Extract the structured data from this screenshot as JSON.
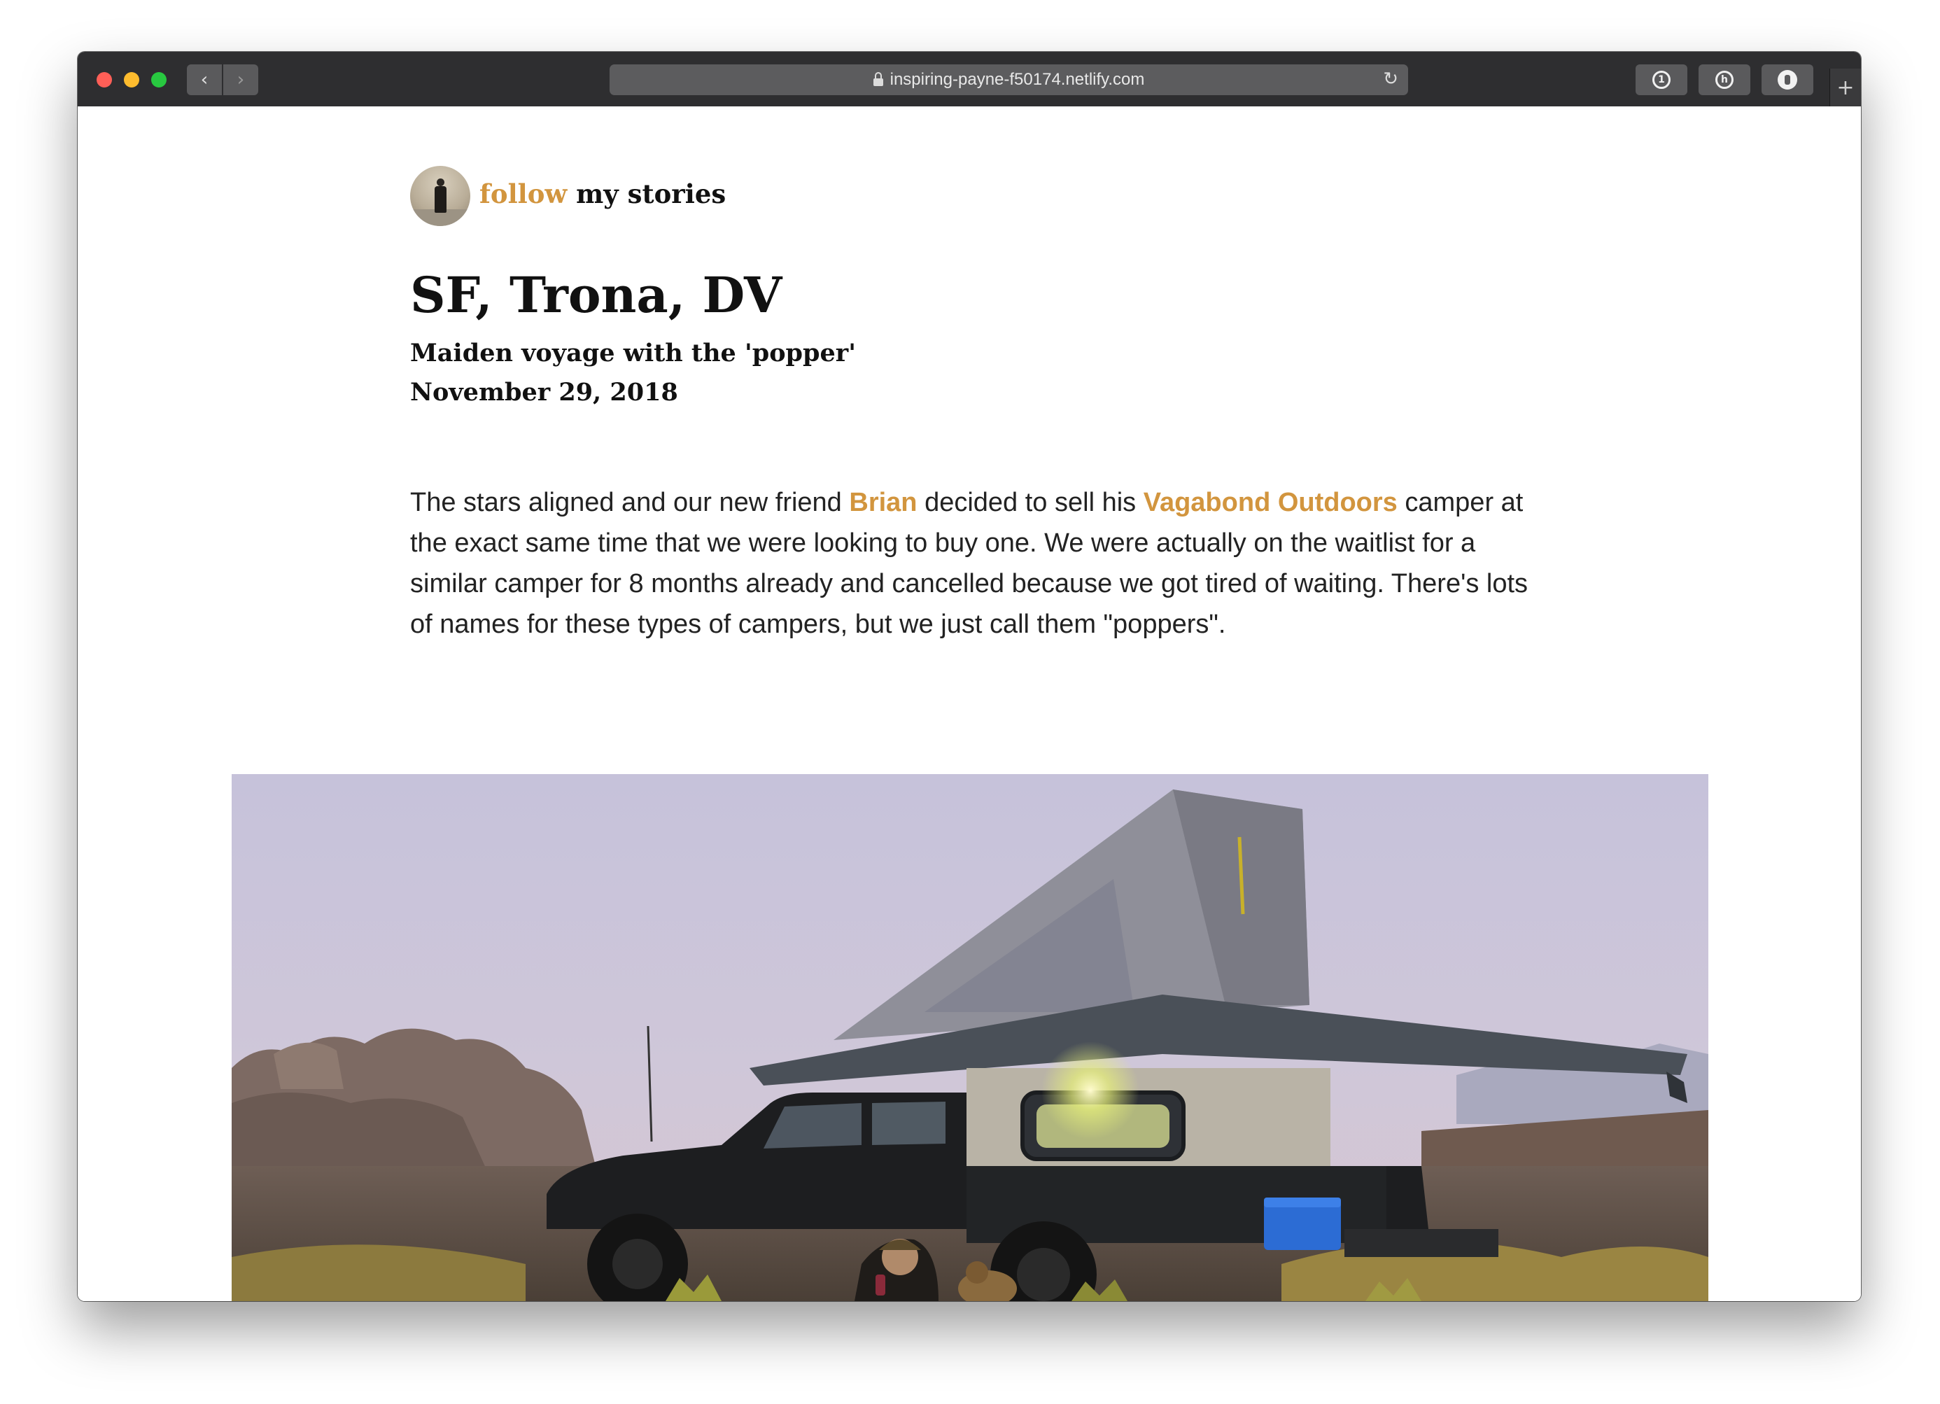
{
  "browser": {
    "url": "inspiring-payne-f50174.netlify.com",
    "nav_back_glyph": "‹",
    "nav_forward_glyph": "›",
    "reload_glyph": "↻",
    "new_tab_glyph": "+",
    "extensions": [
      "onepassword-icon",
      "honey-icon",
      "ghostery-icon"
    ]
  },
  "header": {
    "follow": "follow",
    "my_stories": "my stories"
  },
  "post": {
    "title": "SF, Trona, DV",
    "subtitle": "Maiden voyage with the 'popper'",
    "date": "November 29, 2018",
    "para_1": "The stars aligned and our new friend ",
    "link_brian": "Brian",
    "para_2": " decided to sell his ",
    "link_vagabond": "Vagabond Outdoors",
    "para_3": " camper at the exact same time that we were looking to buy one. We were actually on the waitlist for a similar camper for 8 months already and cancelled because we got tired of waiting. There's lots of names for these types of campers, but we just call them \"poppers\"."
  },
  "colors": {
    "accent": "#d2953e",
    "toolbar": "#2e2e30",
    "text": "#222222"
  }
}
